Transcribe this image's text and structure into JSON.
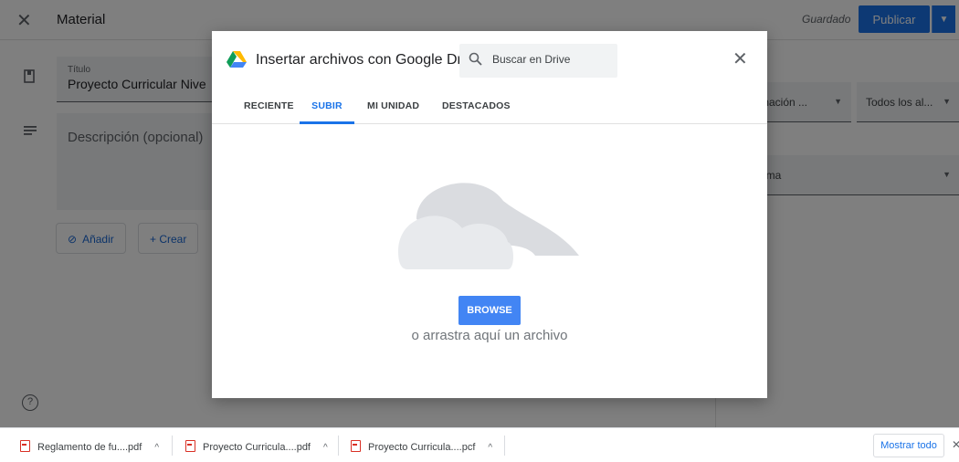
{
  "topbar": {
    "close_icon": "close-icon",
    "title": "Material",
    "saved_status": "Guardado",
    "publish_label": "Publicar",
    "accent_color": "#1a73e8"
  },
  "form": {
    "title_label": "Título",
    "title_value": "Proyecto Curricular Nivel Pri",
    "description_placeholder": "Descripción (opcional)",
    "add_label": "Añadir",
    "create_label": "+ Crear"
  },
  "right_panel": {
    "dropdown1": "mación ...",
    "dropdown2": "Todos los al...",
    "dropdown3": "ema"
  },
  "dialog": {
    "title": "Insertar archivos con Google Drive",
    "search_placeholder": "Buscar en Drive",
    "tabs": [
      {
        "label": "RECIENTE",
        "active": false
      },
      {
        "label": "SUBIR",
        "active": true
      },
      {
        "label": "MI UNIDAD",
        "active": false
      },
      {
        "label": "DESTACADOS",
        "active": false
      }
    ],
    "browse_label": "BROWSE",
    "drag_text": "o arrastra aquí un archivo"
  },
  "downloads": {
    "items": [
      {
        "name": "Reglamento de fu....pdf"
      },
      {
        "name": "Proyecto Curricula....pdf"
      },
      {
        "name": "Proyecto Curricula....pcf"
      }
    ],
    "show_all_label": "Mostrar todo"
  }
}
